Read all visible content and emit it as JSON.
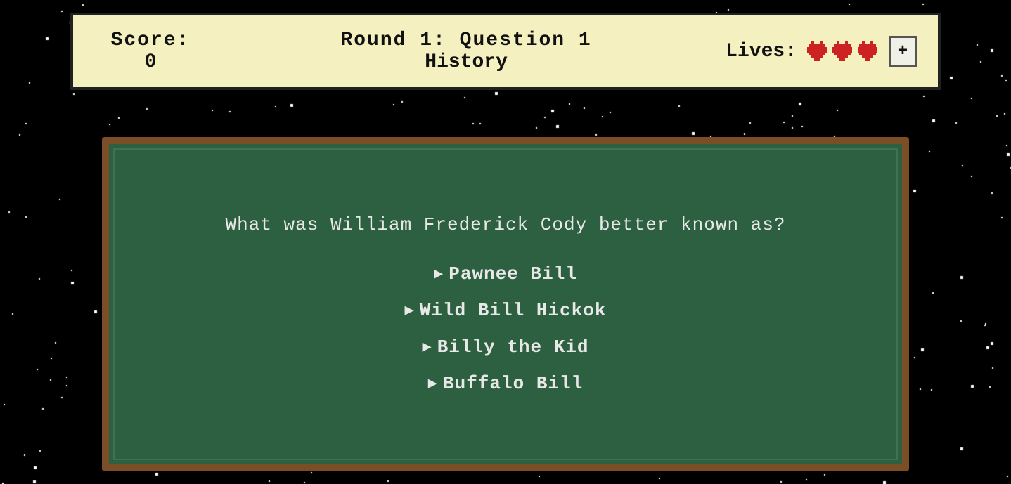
{
  "header": {
    "score_label": "Score:",
    "score_value": "0",
    "round_title": "Round 1: Question 1",
    "round_category": "History",
    "lives_label": "Lives:",
    "lives_count": 3,
    "plus_label": "+"
  },
  "chalkboard": {
    "question": "What was William Frederick Cody better known as?",
    "answers": [
      {
        "text": "Pawnee Bill",
        "arrow": "▶"
      },
      {
        "text": "Wild Bill Hickok",
        "arrow": "▶"
      },
      {
        "text": "Billy the Kid",
        "arrow": "▶"
      },
      {
        "text": "Buffalo Bill",
        "arrow": "▶"
      }
    ]
  },
  "colors": {
    "background": "#000000",
    "header_bg": "#f5f0c0",
    "chalkboard_bg": "#2d6040",
    "chalkboard_border": "#7a4f28",
    "heart_color": "#cc2222",
    "text_dark": "#111111",
    "text_chalk": "#e8e8e8"
  }
}
